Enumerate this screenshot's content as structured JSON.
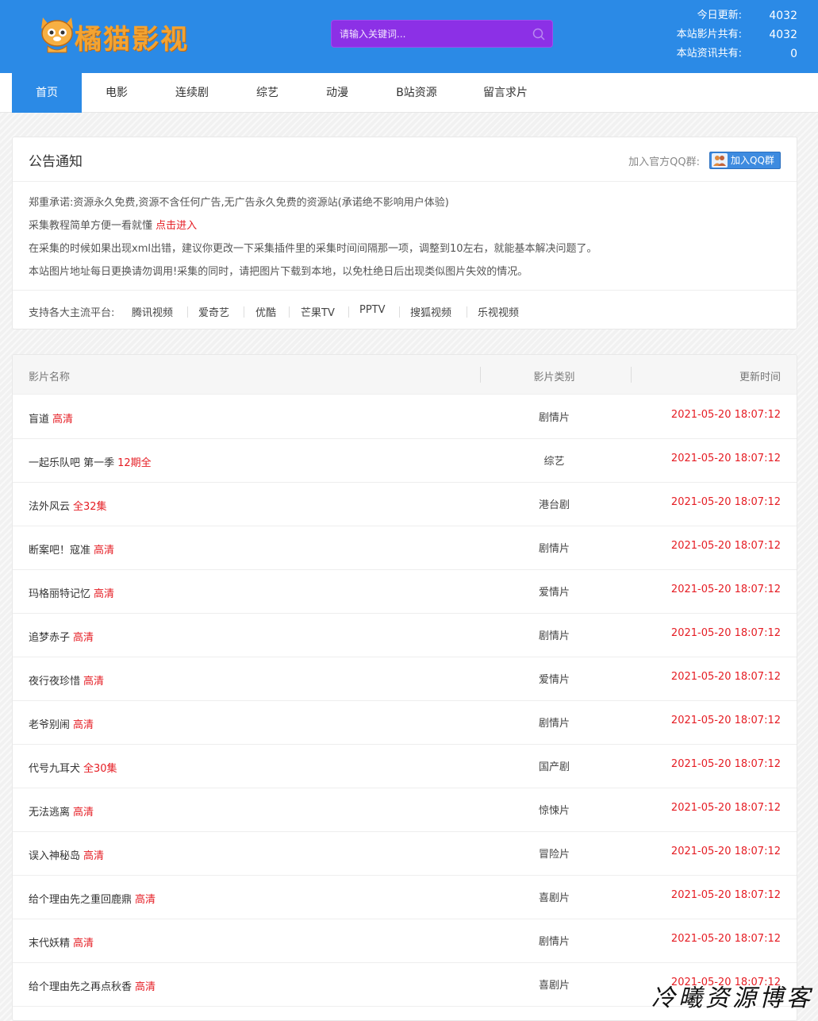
{
  "site": {
    "logo_text": "橘猫影视",
    "search_placeholder": "请输入关键词..."
  },
  "stats": [
    {
      "label": "今日更新:",
      "value": "4032"
    },
    {
      "label": "本站影片共有:",
      "value": "4032"
    },
    {
      "label": "本站资讯共有:",
      "value": "0"
    }
  ],
  "nav": [
    {
      "label": "首页",
      "active": true
    },
    {
      "label": "电影"
    },
    {
      "label": "连续剧"
    },
    {
      "label": "综艺"
    },
    {
      "label": "动漫"
    },
    {
      "label": "B站资源"
    },
    {
      "label": "留言求片"
    }
  ],
  "notice": {
    "title": "公告通知",
    "qq_label": "加入官方QQ群:",
    "qq_button": "加入QQ群",
    "line1": "郑重承诺:资源永久免费,资源不含任何广告,无广告永久免费的资源站(承诺绝不影响用户体验)",
    "line2_prefix": "采集教程简单方便一看就懂 ",
    "line2_link": "点击进入",
    "line3": "在采集的时候如果出现xml出错，建议你更改一下采集插件里的采集时间间隔那一项，调整到10左右，就能基本解决问题了。",
    "line4": "本站图片地址每日更换请勿调用!采集的同时，请把图片下载到本地，以免杜绝日后出现类似图片失效的情况。",
    "platform_label": "支持各大主流平台:",
    "platforms": [
      "腾讯视频",
      "爱奇艺",
      "优酷",
      "芒果TV",
      "PPTV",
      "搜狐视频",
      "乐视视频"
    ]
  },
  "table": {
    "headers": {
      "name": "影片名称",
      "type": "影片类别",
      "time": "更新时间"
    },
    "rows": [
      {
        "name": "盲道",
        "badge": "高清",
        "type": "剧情片",
        "time": "2021-05-20 18:07:12"
      },
      {
        "name": "一起乐队吧 第一季",
        "badge": "12期全",
        "type": "综艺",
        "time": "2021-05-20 18:07:12"
      },
      {
        "name": "法外风云",
        "badge": "全32集",
        "type": "港台剧",
        "time": "2021-05-20 18:07:12"
      },
      {
        "name": "断案吧！寇准",
        "badge": "高清",
        "type": "剧情片",
        "time": "2021-05-20 18:07:12"
      },
      {
        "name": "玛格丽特记忆",
        "badge": "高清",
        "type": "爱情片",
        "time": "2021-05-20 18:07:12"
      },
      {
        "name": "追梦赤子",
        "badge": "高清",
        "type": "剧情片",
        "time": "2021-05-20 18:07:12"
      },
      {
        "name": "夜行夜珍惜",
        "badge": "高清",
        "type": "爱情片",
        "time": "2021-05-20 18:07:12"
      },
      {
        "name": "老爷别闹",
        "badge": "高清",
        "type": "剧情片",
        "time": "2021-05-20 18:07:12"
      },
      {
        "name": "代号九耳犬",
        "badge": "全30集",
        "type": "国产剧",
        "time": "2021-05-20 18:07:12"
      },
      {
        "name": "无法逃离",
        "badge": "高清",
        "type": "惊悚片",
        "time": "2021-05-20 18:07:12"
      },
      {
        "name": "误入神秘岛",
        "badge": "高清",
        "type": "冒险片",
        "time": "2021-05-20 18:07:12"
      },
      {
        "name": "给个理由先之重回鹿鼎",
        "badge": "高清",
        "type": "喜剧片",
        "time": "2021-05-20 18:07:12"
      },
      {
        "name": "末代妖精",
        "badge": "高清",
        "type": "剧情片",
        "time": "2021-05-20 18:07:12"
      },
      {
        "name": "给个理由先之再点秋香",
        "badge": "高清",
        "type": "喜剧片",
        "time": "2021-05-20 18:07:12"
      }
    ]
  },
  "watermark": "冷曦资源博客",
  "colors": {
    "primary": "#2b8ae6",
    "search_bg": "#8c30e6",
    "accent_red": "#e51c23",
    "logo_orange": "#f3a331"
  }
}
